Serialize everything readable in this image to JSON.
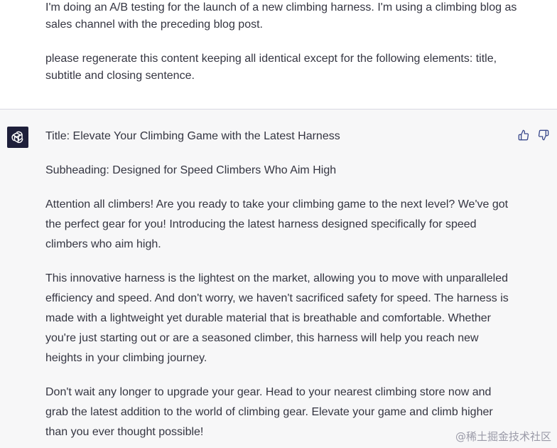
{
  "user_message": {
    "paragraph_1": "I'm doing an A/B testing for the launch of a new climbing harness. I'm using a climbing blog as sales channel with the preceding blog post.",
    "paragraph_2": "please regenerate this content keeping all identical except for the following elements: title, subtitle and closing sentence."
  },
  "assistant_message": {
    "avatar_icon": "openai-logo-icon",
    "title_line": "Title: Elevate Your Climbing Game with the Latest Harness",
    "subheading_line": "Subheading: Designed for Speed Climbers Who Aim High",
    "paragraph_1": "Attention all climbers! Are you ready to take your climbing game to the next level? We've got the perfect gear for you! Introducing the latest harness designed specifically for speed climbers who aim high.",
    "paragraph_2": "This innovative harness is the lightest on the market, allowing you to move with unparalleled efficiency and speed. And don't worry, we haven't sacrificed safety for speed. The harness is made with a lightweight yet durable material that is breathable and comfortable. Whether you're just starting out or are a seasoned climber, this harness will help you reach new heights in your climbing journey.",
    "paragraph_3": "Don't wait any longer to upgrade your gear. Head to your nearest climbing store now and grab the latest addition to the world of climbing gear. Elevate your game and climb higher than you ever thought possible!"
  },
  "feedback": {
    "thumbs_up_icon": "thumbs-up-icon",
    "thumbs_down_icon": "thumbs-down-icon"
  },
  "watermark": {
    "text": "@稀土掘金技术社区"
  },
  "colors": {
    "user_bg": "#ffffff",
    "assistant_bg": "#f7f7f8",
    "text": "#343541",
    "avatar_bg": "#1e1f3a",
    "icon": "#3b4a8c"
  }
}
